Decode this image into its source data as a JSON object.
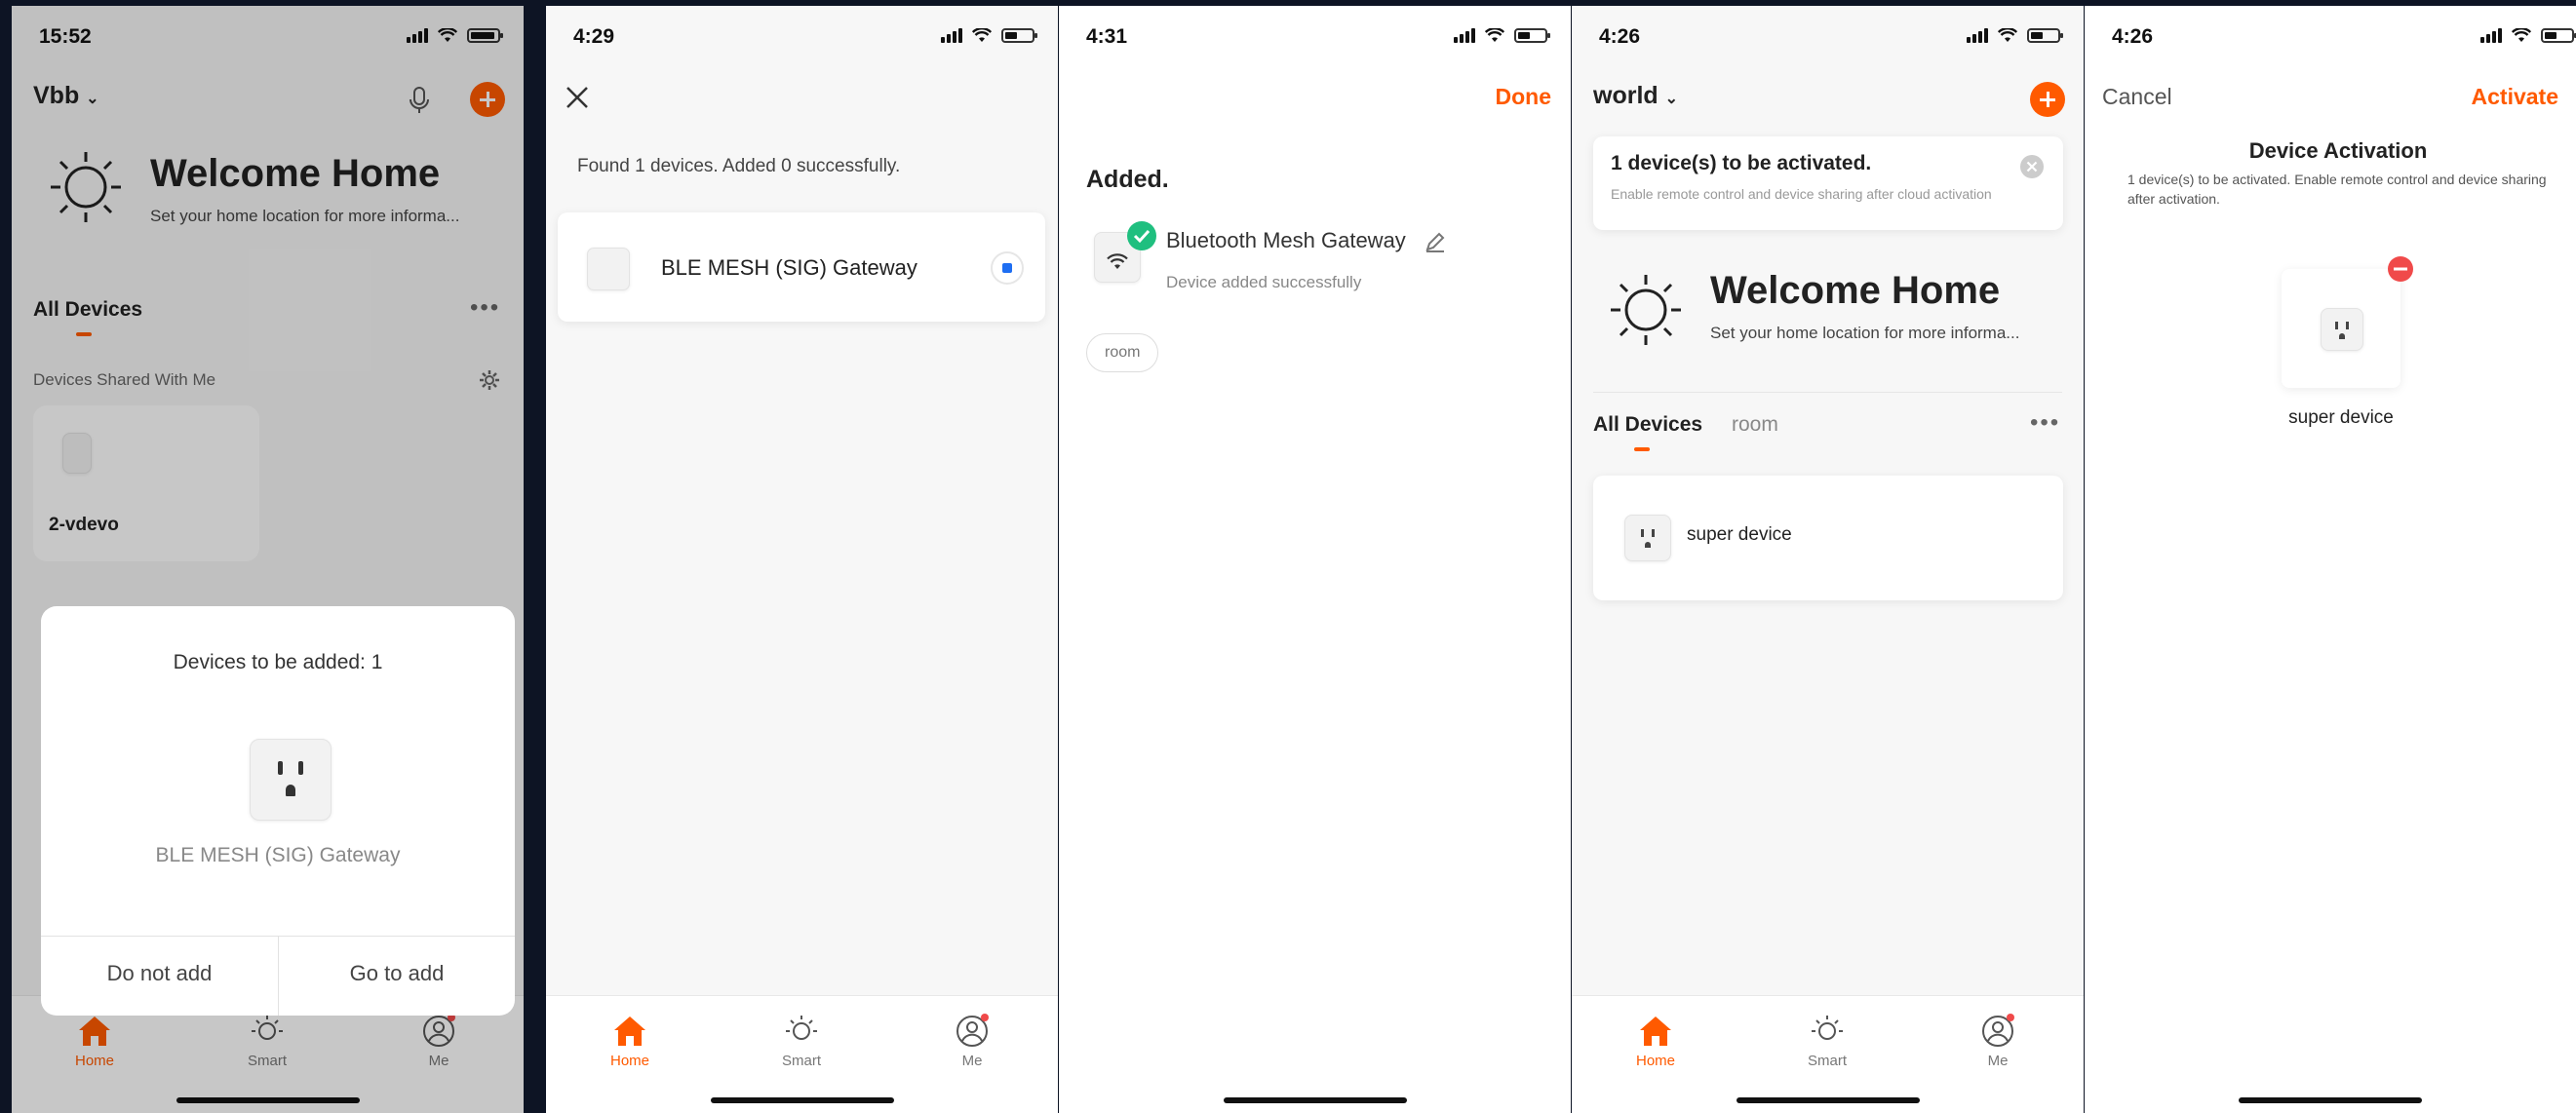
{
  "screen1": {
    "time": "15:52",
    "home_name": "Vbb",
    "welcome_title": "Welcome Home",
    "welcome_subtitle": "Set your home location for more informa...",
    "tab_all_devices": "All Devices",
    "section_shared": "Devices Shared With Me",
    "shared_device": "2-vdevo",
    "dialog_title": "Devices to be added: 1",
    "dialog_device": "BLE MESH (SIG) Gateway",
    "btn_do_not_add": "Do not add",
    "btn_go_to_add": "Go to add",
    "tabs": [
      "Home",
      "Smart",
      "Me"
    ]
  },
  "screen2": {
    "time": "4:29",
    "found_text": "Found 1 devices. Added 0 successfully.",
    "device_name": "BLE MESH (SIG) Gateway",
    "tabs": [
      "Home",
      "Smart",
      "Me"
    ]
  },
  "screen3": {
    "time": "4:31",
    "done": "Done",
    "added_title": "Added.",
    "device_name": "Bluetooth Mesh Gateway",
    "device_status": "Device added successfully",
    "room_chip": "room"
  },
  "screen4": {
    "time": "4:26",
    "home_name": "world",
    "banner_title": "1 device(s) to be activated.",
    "banner_desc": "Enable remote control and device sharing after cloud activation",
    "welcome_title": "Welcome Home",
    "welcome_subtitle": "Set your home location for more informa...",
    "tab_all_devices": "All Devices",
    "tab_room": "room",
    "device_name": "super device",
    "tabs": [
      "Home",
      "Smart",
      "Me"
    ]
  },
  "screen5": {
    "time": "4:26",
    "cancel": "Cancel",
    "activate": "Activate",
    "title": "Device Activation",
    "desc": "1 device(s) to be activated. Enable remote control and device sharing after activation.",
    "device_name": "super device"
  },
  "colors": {
    "accent": "#ff5a00",
    "success": "#1fbf7f",
    "remove": "#f04a4a"
  }
}
